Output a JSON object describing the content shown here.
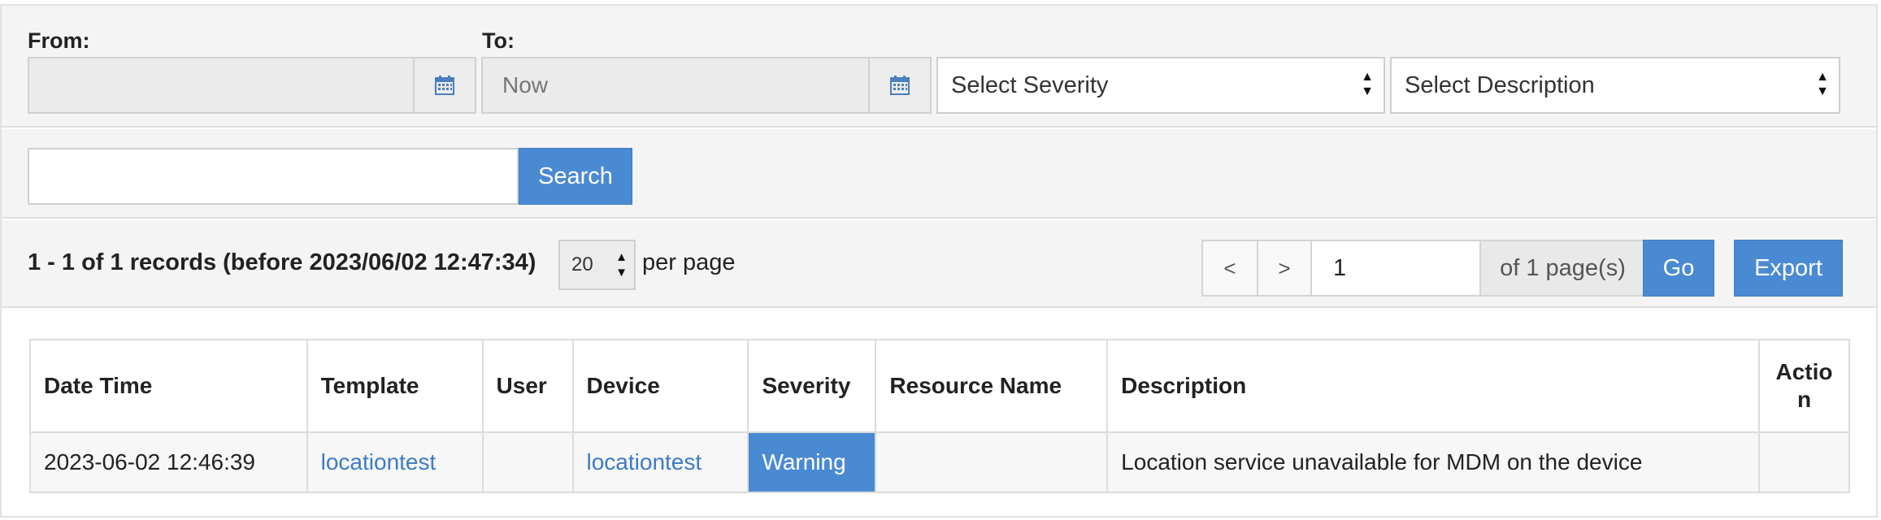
{
  "filters": {
    "from_label": "From:",
    "from_value": "",
    "to_label": "To:",
    "to_placeholder": "Now",
    "severity_select": "Select Severity",
    "description_select": "Select Description"
  },
  "search": {
    "input_value": "",
    "button_label": "Search"
  },
  "paging": {
    "records_summary": "1 - 1 of 1 records (before 2023/06/02 12:47:34)",
    "per_page_value": "20",
    "per_page_label": "per page",
    "prev_label": "<",
    "next_label": ">",
    "page_value": "1",
    "of_pages": "of 1 page(s)",
    "go_label": "Go",
    "export_label": "Export"
  },
  "table": {
    "columns": [
      "Date Time",
      "Template",
      "User",
      "Device",
      "Severity",
      "Resource Name",
      "Description",
      "Actio\nn"
    ],
    "rows": [
      {
        "datetime": "2023-06-02 12:46:39",
        "template": "locationtest",
        "user": "",
        "device": "locationtest",
        "severity": "Warning",
        "resource_name": "",
        "description": "Location service unavailable for MDM on the device",
        "action": ""
      }
    ]
  },
  "colors": {
    "accent": "#4a8ad3",
    "link": "#3b7bc5",
    "panel_bg": "#f4f4f4"
  },
  "icons": {
    "calendar": "calendar-icon",
    "select_arrows": "sort-arrows-icon"
  }
}
